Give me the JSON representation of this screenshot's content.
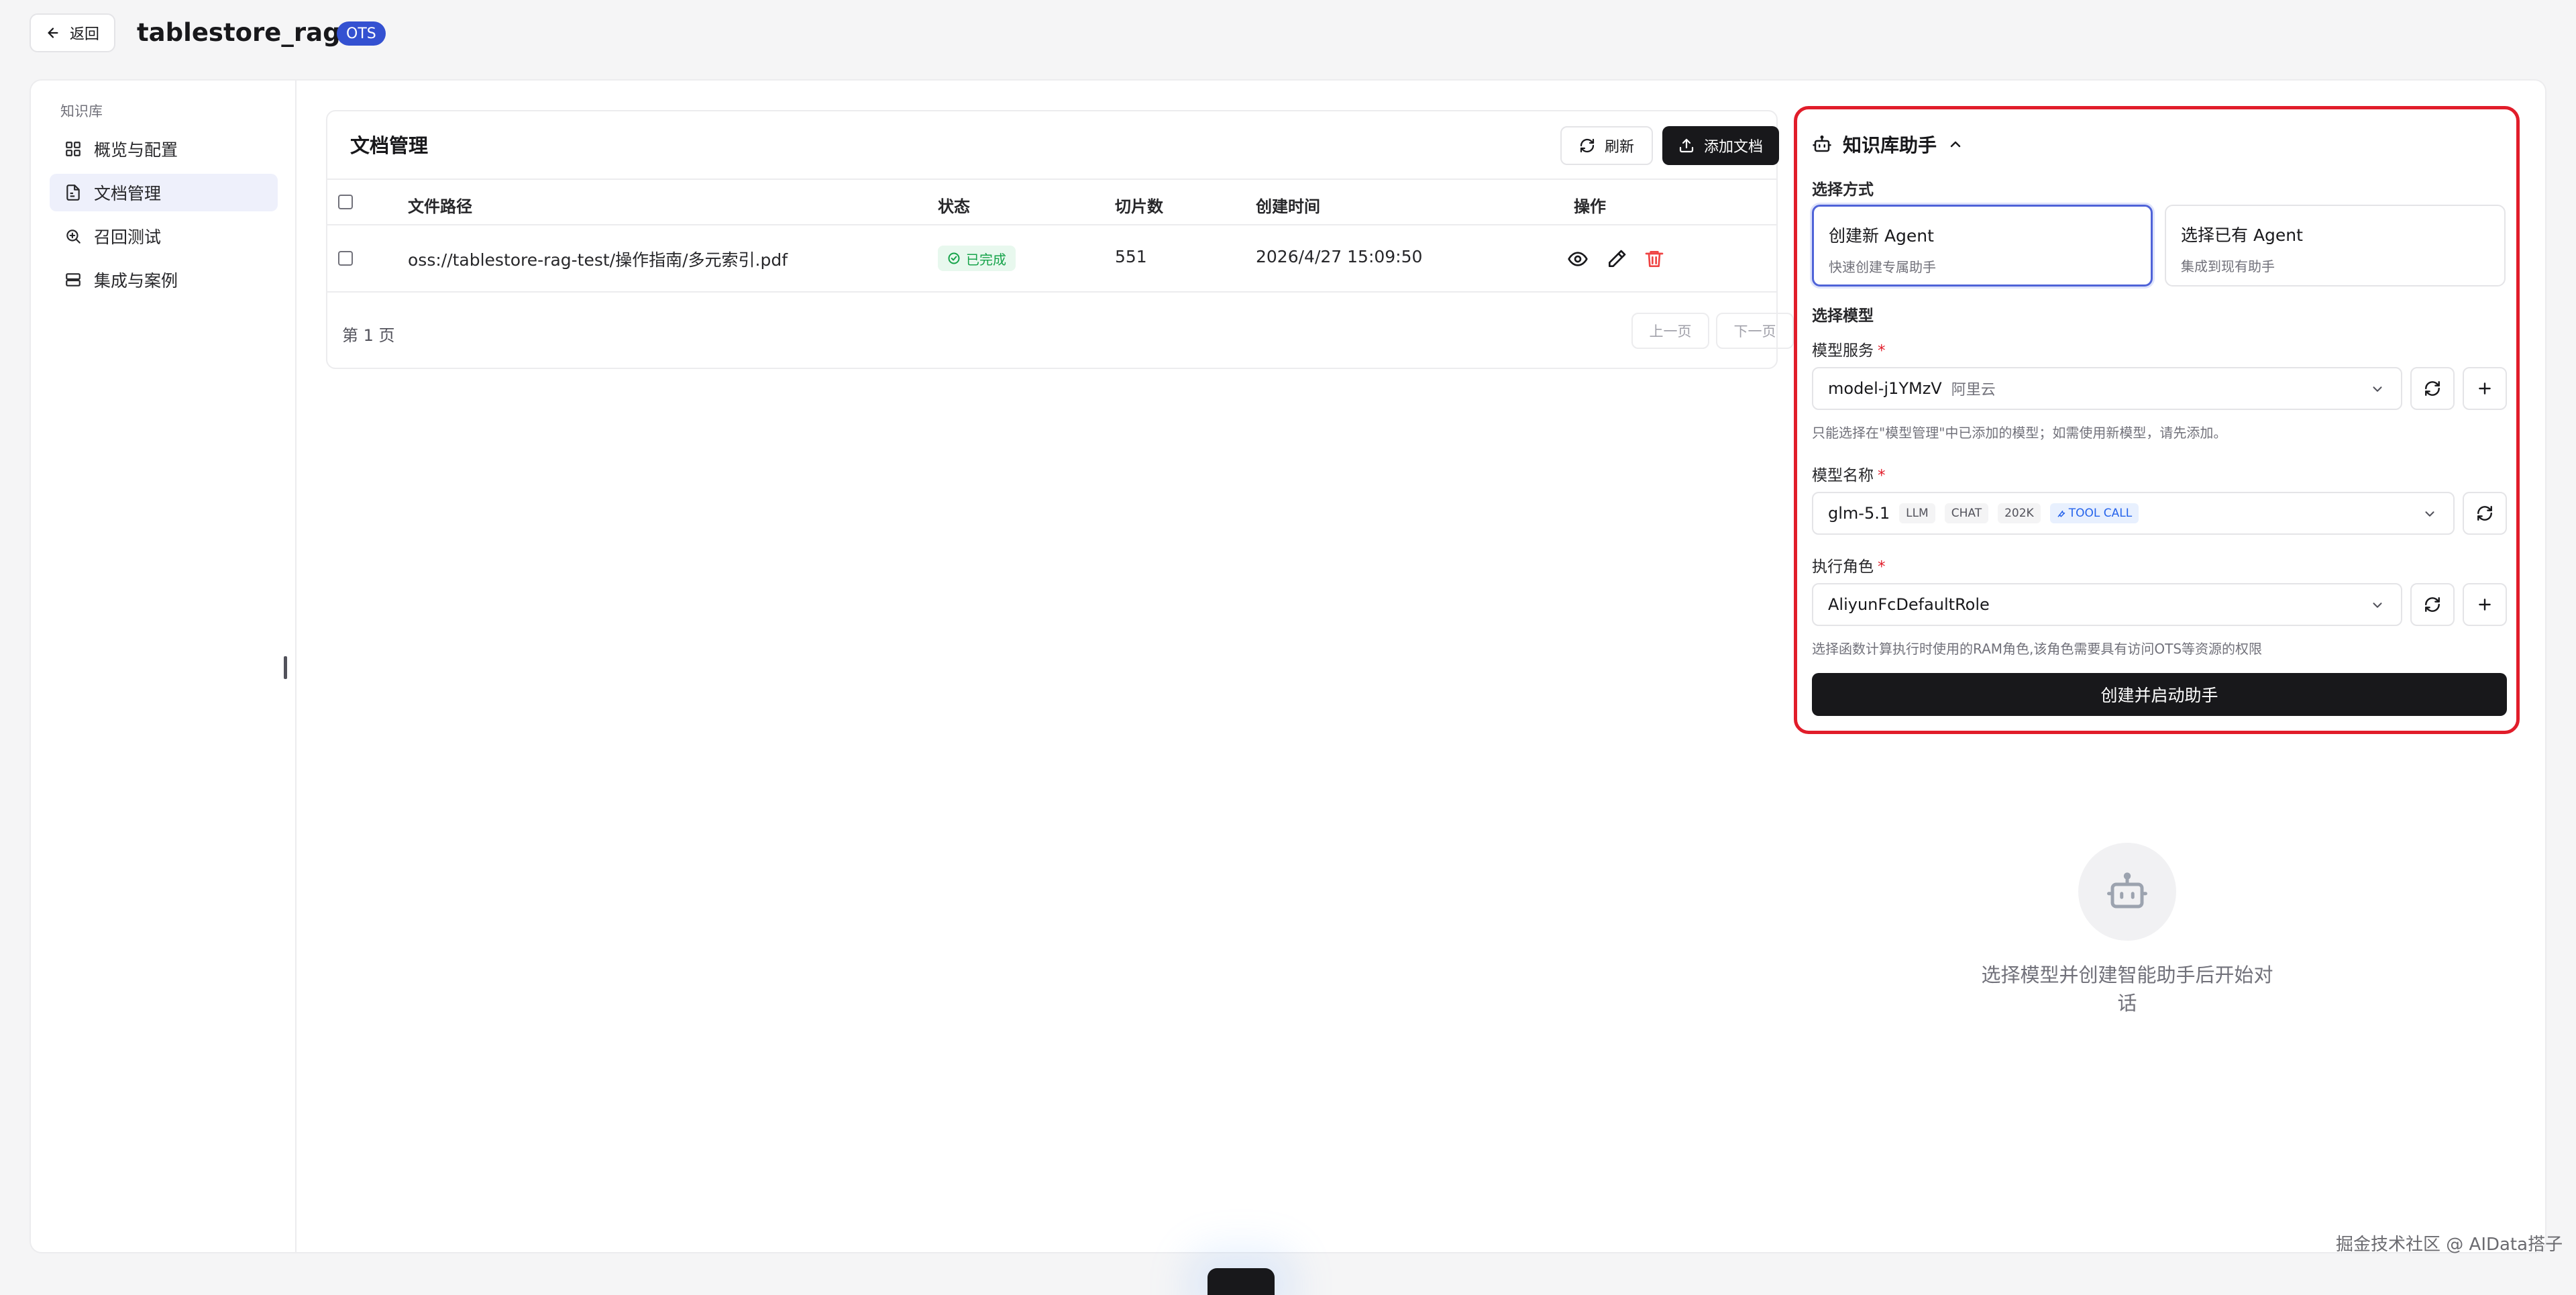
{
  "header": {
    "back_label": "返回",
    "title": "tablestore_rag",
    "badge": "OTS"
  },
  "sidebar": {
    "heading": "知识库",
    "items": [
      {
        "label": "概览与配置",
        "icon": "grid-icon",
        "active": false
      },
      {
        "label": "文档管理",
        "icon": "document-icon",
        "active": true
      },
      {
        "label": "召回测试",
        "icon": "search-doc-icon",
        "active": false
      },
      {
        "label": "集成与案例",
        "icon": "server-stack-icon",
        "active": false
      }
    ]
  },
  "documents": {
    "title": "文档管理",
    "refresh_label": "刷新",
    "add_label": "添加文档",
    "columns": [
      "文件路径",
      "状态",
      "切片数",
      "创建时间",
      "操作"
    ],
    "rows": [
      {
        "path": "oss://tablestore-rag-test/操作指南/多元索引.pdf",
        "status": "已完成",
        "chunks": "551",
        "created": "2026/4/27 15:09:50"
      }
    ],
    "page_label": "第 1 页",
    "prev_label": "上一页",
    "next_label": "下一页"
  },
  "assistant": {
    "title": "知识库助手",
    "mode_label": "选择方式",
    "modes": [
      {
        "title": "创建新 Agent",
        "subtitle": "快速创建专属助手",
        "selected": true
      },
      {
        "title": "选择已有 Agent",
        "subtitle": "集成到现有助手",
        "selected": false
      }
    ],
    "model_section": "选择模型",
    "model_service_label": "模型服务",
    "model_service_value": "model-j1YMzV",
    "model_service_provider": "阿里云",
    "model_service_hint": "只能选择在\"模型管理\"中已添加的模型；如需使用新模型，请先添加。",
    "model_name_label": "模型名称",
    "model_name_value": "glm-5.1",
    "model_tags": [
      "LLM",
      "CHAT",
      "202K"
    ],
    "tool_tag": "TOOL CALL",
    "role_label": "执行角色",
    "role_value": "AliyunFcDefaultRole",
    "role_hint": "选择函数计算执行时使用的RAM角色,该角色需要具有访问OTS等资源的权限",
    "required_mark": "*",
    "submit_label": "创建并启动助手",
    "highlight_color": "#e11d2a"
  },
  "empty_state": {
    "message": "选择模型并创建智能助手后开始对话",
    "icon": "bot-icon"
  },
  "watermark": "掘金技术社区 @ AIData搭子"
}
